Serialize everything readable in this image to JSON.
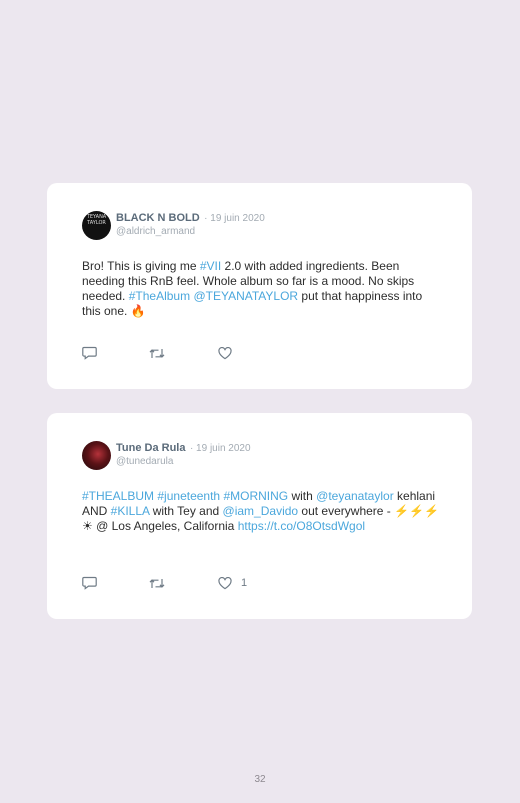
{
  "tweets": [
    {
      "avatar_text": "TEYANA TAYLOR",
      "name": "BLACK N BOLD",
      "date": "· 19 juin 2020",
      "handle": "@aldrich_armand",
      "body": [
        {
          "text": "Bro! This is giving me ",
          "link": false
        },
        {
          "text": "#VII",
          "link": true
        },
        {
          "text": " 2.0 with added ingredients. Been needing this RnB feel. Whole album so far is a mood. No skips needed. ",
          "link": false
        },
        {
          "text": "#TheAlbum",
          "link": true
        },
        {
          "text": " ",
          "link": false
        },
        {
          "text": "@TEYANATAYLOR",
          "link": true
        },
        {
          "text": " put that happiness into this one. 🔥",
          "link": false
        }
      ],
      "likes": ""
    },
    {
      "avatar_text": "",
      "name": "Tune Da Rula",
      "date": "· 19 juin 2020",
      "handle": "@tunedarula",
      "body": [
        {
          "text": "#THEALBUM",
          "link": true
        },
        {
          "text": " ",
          "link": false
        },
        {
          "text": "#juneteenth",
          "link": true
        },
        {
          "text": " ",
          "link": false
        },
        {
          "text": "#MORNING",
          "link": true
        },
        {
          "text": " with ",
          "link": false
        },
        {
          "text": "@teyanataylor",
          "link": true
        },
        {
          "text": " kehlani AND ",
          "link": false
        },
        {
          "text": "#KILLA",
          "link": true
        },
        {
          "text": " with Tey and ",
          "link": false
        },
        {
          "text": "@iam_Davido",
          "link": true
        },
        {
          "text": " out everywhere - ⚡⚡⚡☀ @ Los Angeles, California ",
          "link": false
        },
        {
          "text": "https://t.co/O8OtsdWgol",
          "link": true
        }
      ],
      "likes": "1"
    }
  ],
  "icons": {
    "reply": "reply-icon",
    "retweet": "retweet-icon",
    "like": "heart-icon"
  },
  "colors": {
    "link": "#4ba7dc",
    "background": "#ece7ef",
    "card": "#ffffff"
  },
  "page_number": "32"
}
